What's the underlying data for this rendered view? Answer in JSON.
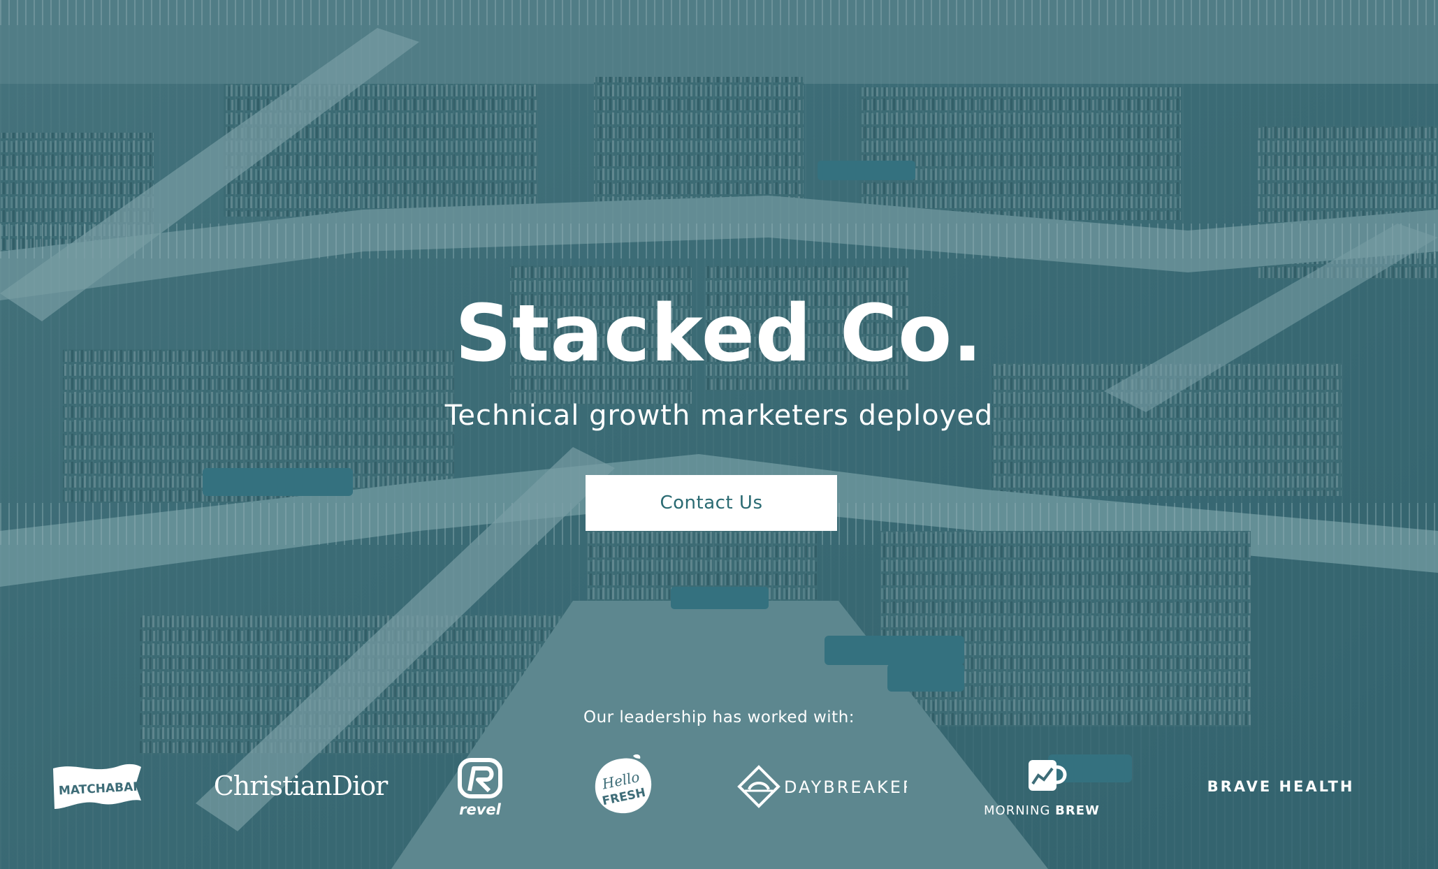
{
  "hero": {
    "title": "Stacked Co.",
    "subtitle": "Technical growth marketers deployed",
    "cta_label": "Contact Us",
    "background_image": "library-atrium-icon"
  },
  "clients": {
    "heading": "Our leadership has worked with:",
    "logos": [
      {
        "name": "matchabar-logo",
        "text": "MATCHABAR"
      },
      {
        "name": "christian-dior-logo",
        "text": "ChristianDior"
      },
      {
        "name": "revel-logo",
        "text": "revel"
      },
      {
        "name": "hellofresh-logo",
        "text_line1": "Hello",
        "text_line2": "FRESH"
      },
      {
        "name": "daybreaker-logo",
        "text": "DAYBREAKER"
      },
      {
        "name": "morning-brew-logo",
        "text_light": "MORNING ",
        "text_bold": "BREW"
      },
      {
        "name": "brave-health-logo",
        "text": "BRAVE HEALTH"
      }
    ]
  },
  "colors": {
    "overlay": "#2f6a73",
    "button_bg": "#ffffff",
    "button_text": "#2a6a72",
    "text": "#ffffff"
  }
}
